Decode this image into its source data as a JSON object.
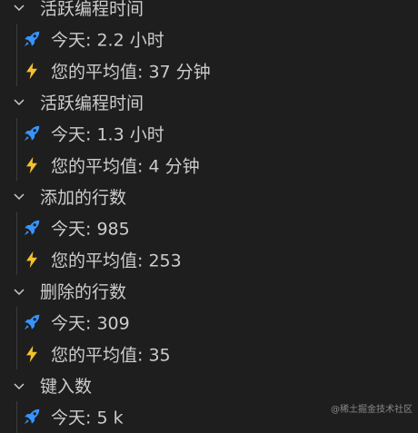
{
  "groups": [
    {
      "label": "活跃编程时间",
      "items": [
        {
          "icon": "rocket-icon",
          "text": "今天:  2.2 小时"
        },
        {
          "icon": "lightning-icon",
          "text": "您的平均值: 37 分钟"
        }
      ]
    },
    {
      "label": "活跃编程时间",
      "items": [
        {
          "icon": "rocket-icon",
          "text": "今天:  1.3 小时"
        },
        {
          "icon": "lightning-icon",
          "text": "您的平均值: 4 分钟"
        }
      ]
    },
    {
      "label": "添加的行数",
      "items": [
        {
          "icon": "rocket-icon",
          "text": "今天:  985"
        },
        {
          "icon": "lightning-icon",
          "text": "您的平均值: 253"
        }
      ]
    },
    {
      "label": "删除的行数",
      "items": [
        {
          "icon": "rocket-icon",
          "text": "今天:  309"
        },
        {
          "icon": "lightning-icon",
          "text": "您的平均值: 35"
        }
      ]
    },
    {
      "label": "键入数",
      "items": [
        {
          "icon": "rocket-icon",
          "text": "今天:  5 k"
        }
      ]
    }
  ],
  "colors": {
    "rocket": "#3794ff",
    "lightning": "#f4c22b",
    "chevron": "#cccccc"
  },
  "watermark": "@稀土掘金技术社区"
}
